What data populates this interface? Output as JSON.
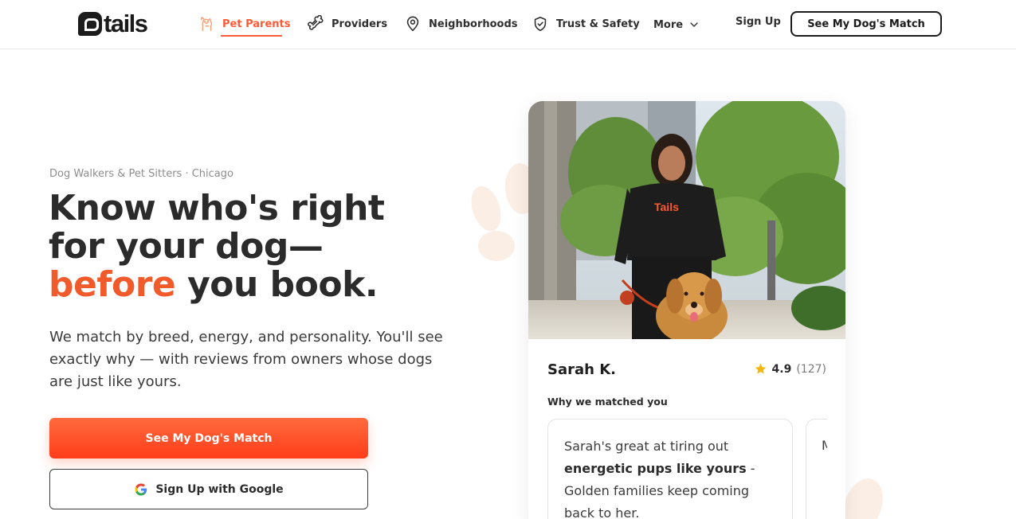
{
  "brand": {
    "name": "tails"
  },
  "nav": {
    "items": [
      {
        "label": "Pet Parents",
        "icon": "dog-icon",
        "active": true
      },
      {
        "label": "Providers",
        "icon": "bone-icon",
        "active": false
      },
      {
        "label": "Neighborhoods",
        "icon": "map-pin-icon",
        "active": false
      },
      {
        "label": "Trust & Safety",
        "icon": "shield-check-icon",
        "active": false
      },
      {
        "label": "More",
        "icon": "chevron-down-icon",
        "active": false
      }
    ],
    "signup_label": "Sign Up",
    "cta_label": "See My Dog's Match"
  },
  "hero": {
    "eyebrow": "Dog Walkers & Pet Sitters · Chicago",
    "headline_line1": "Know who's right",
    "headline_line2": "for your dog—",
    "headline_accent": "before",
    "headline_rest": " you book.",
    "subhead": "We match by breed, energy, and personality. You'll see exactly why — with reviews from owners whose dogs are just like yours.",
    "primary_cta": "See My Dog's Match",
    "google_cta": "Sign Up with Google"
  },
  "card": {
    "photo_shirt_text": "Tails",
    "walker_name": "Sarah K.",
    "rating_value": "4.9",
    "rating_count": "(127)",
    "match_label": "Why we matched you",
    "reason_prefix": "Sarah's great at tiring out ",
    "reason_bold": "energetic pups like yours",
    "reason_suffix": " - Golden families keep coming back to her.",
    "next_reason_peek": "M a -"
  },
  "colors": {
    "accent": "#f15a2b",
    "cta_gradient_top": "#ff6a3d",
    "cta_gradient_bottom": "#ff3d1a",
    "paw": "#fbeee4",
    "star": "#f5b60d"
  }
}
